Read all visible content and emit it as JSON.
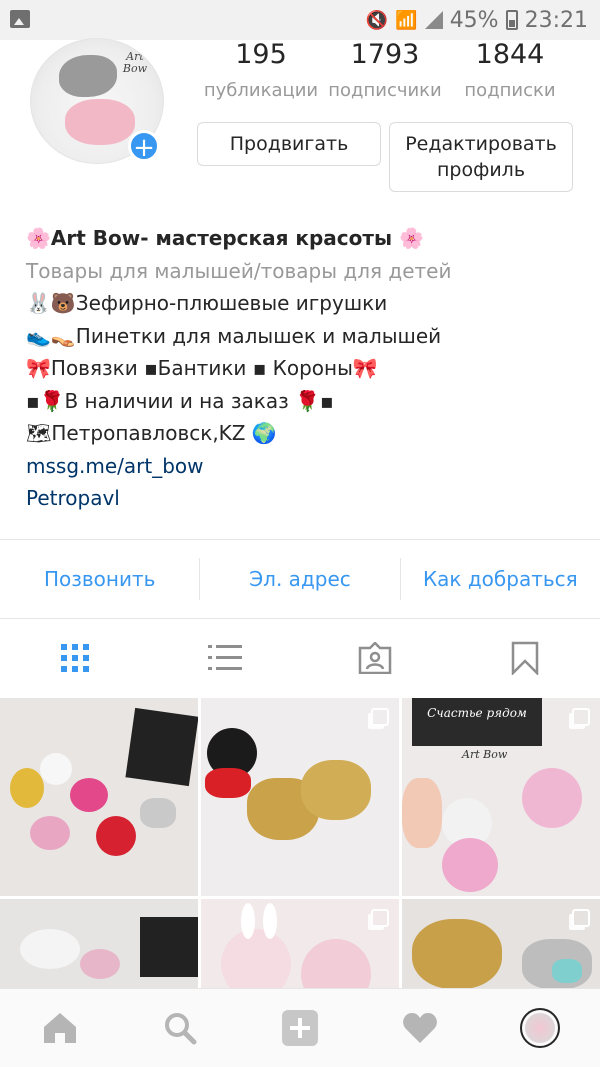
{
  "status_bar": {
    "battery": "45%",
    "time": "23:21"
  },
  "profile": {
    "avatar_text": "Art\nBow",
    "stats": [
      {
        "value": "195",
        "label": "публикации"
      },
      {
        "value": "1793",
        "label": "подписчики"
      },
      {
        "value": "1844",
        "label": "подписки"
      }
    ],
    "promote_label": "Продвигать",
    "edit_label_1": "Редактировать",
    "edit_label_2": "профиль"
  },
  "bio": {
    "name": "🌸Art Bow- мастерская красоты 🌸",
    "category": "Товары для малышей/товары для детей",
    "lines": [
      "🐰🐻Зефирно-плюшевые игрушки",
      "👟👡Пинетки для малышек и малышей",
      "🎀Повязки ▪Бантики ▪ Короны🎀",
      "▪🌹В наличии и на заказ 🌹▪",
      "🗺Петропавловск,KZ 🌍"
    ],
    "link": "mssg.me/art_bow",
    "location": "Petropavl"
  },
  "contact": {
    "call": "Позвонить",
    "email": "Эл. адрес",
    "directions": "Как добраться"
  },
  "colors": {
    "accent": "#3897f0",
    "link": "#003569",
    "muted": "#999999"
  },
  "grid_photos": [
    {
      "label": "Счастье рядом",
      "sub": "Art Bow"
    },
    {
      "label": "",
      "sub": ""
    },
    {
      "label": "Счастье рядом",
      "sub": "Art Bow"
    }
  ]
}
